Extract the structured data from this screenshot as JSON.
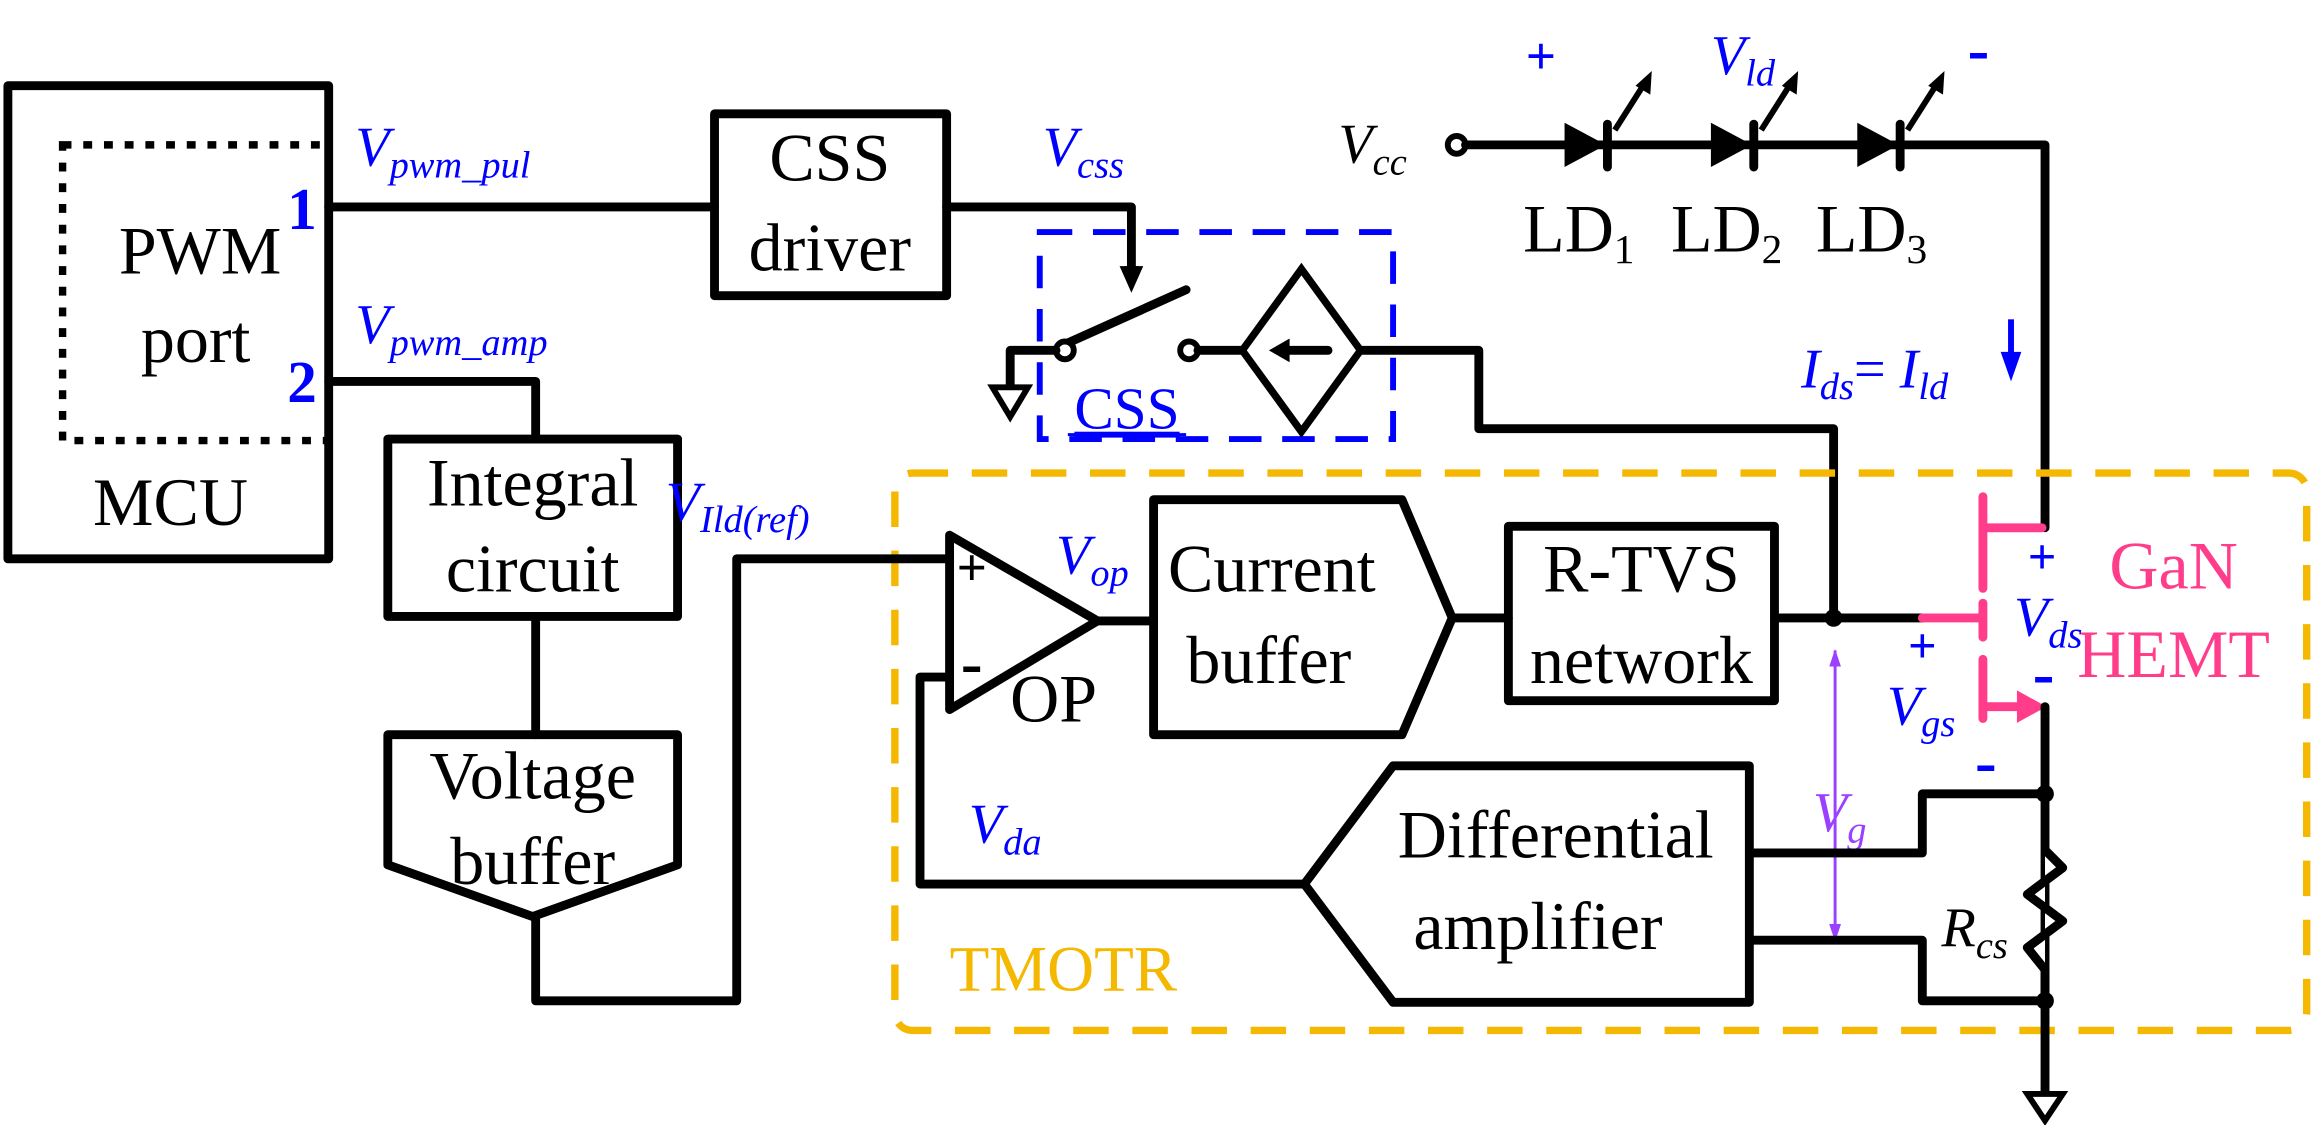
{
  "colors": {
    "wire": "#000000",
    "label_blue": "#0000ff",
    "css_box": "#0000ff",
    "tmotr_box": "#f5b800",
    "hemt": "#ff3d8b",
    "vg_arrow": "#9b40ff"
  },
  "mcu": {
    "title": "MCU",
    "port_line1": "PWM",
    "port_line2": "port",
    "pin1": "1",
    "pin2": "2"
  },
  "signals": {
    "vpwm_pul": {
      "main": "V",
      "sub": "pwm_pul"
    },
    "vpwm_amp": {
      "main": "V",
      "sub": "pwm_amp"
    },
    "vcss": {
      "main": "V",
      "sub": "css"
    },
    "vcc": {
      "main": "V",
      "sub": "cc"
    },
    "vld": {
      "main": "V",
      "sub": "ld"
    },
    "villd": {
      "main": "V",
      "sub": "Ild(ref)"
    },
    "vop": {
      "main": "V",
      "sub": "op"
    },
    "vda": {
      "main": "V",
      "sub": "da"
    },
    "vg": {
      "main": "V",
      "sub": "g"
    },
    "vgs": {
      "main": "V",
      "sub": "gs"
    },
    "vds": {
      "main": "V",
      "sub": "ds"
    },
    "rcs": {
      "main": "R",
      "sub": "cs"
    },
    "ids": {
      "main": "I",
      "sub": "ds",
      "eq": "= ",
      "main2": "I",
      "sub2": "ld"
    }
  },
  "blocks": {
    "css_driver": [
      "CSS",
      "driver"
    ],
    "css": "CSS",
    "integral": [
      "Integral",
      "circuit"
    ],
    "voltage_buffer": [
      "Voltage",
      "buffer"
    ],
    "current_buffer": [
      "Current",
      "buffer"
    ],
    "rtvs": [
      "R-TVS",
      "network"
    ],
    "diff_amp": [
      "Differential",
      "amplifier"
    ],
    "op": "OP",
    "tmotr": "TMOTR",
    "hemt": [
      "GaN",
      "HEMT"
    ]
  },
  "diodes": [
    {
      "name": "LD",
      "sub": "1"
    },
    {
      "name": "LD",
      "sub": "2"
    },
    {
      "name": "LD",
      "sub": "3"
    }
  ],
  "polarity": {
    "plus": "+",
    "minus": "-"
  }
}
